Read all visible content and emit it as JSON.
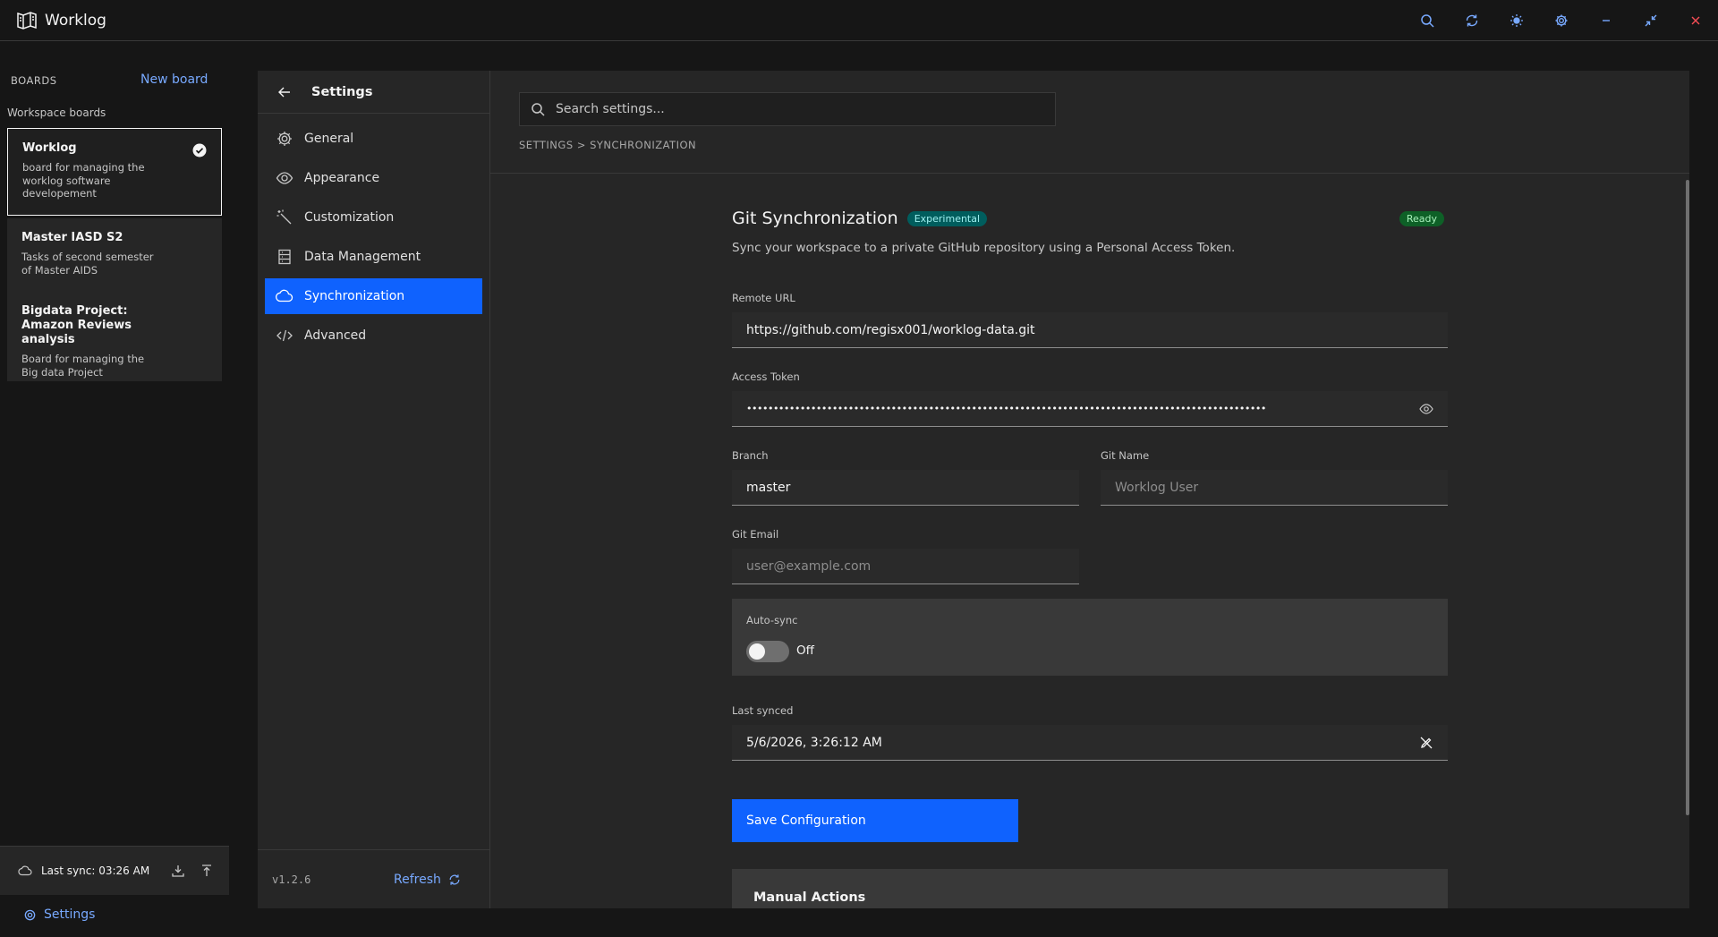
{
  "app": {
    "title": "Worklog"
  },
  "sidebar": {
    "boards_header": "BOARDS",
    "new_board": "New board",
    "workspace_label": "Workspace boards",
    "boards": [
      {
        "title": "Worklog",
        "desc": "board for managing the worklog software developement",
        "active": true
      },
      {
        "title": "Master IASD S2",
        "desc": "Tasks of second semester of Master AIDS",
        "active": false
      },
      {
        "title": "Bigdata Project: Amazon Reviews analysis",
        "desc": "Board for managing the Big data Project",
        "active": false
      }
    ],
    "last_sync": "Last sync: 03:26 AM",
    "settings_label": "Settings"
  },
  "settings_nav": {
    "title": "Settings",
    "items": [
      {
        "label": "General",
        "icon": "gear-icon"
      },
      {
        "label": "Appearance",
        "icon": "eye-icon"
      },
      {
        "label": "Customization",
        "icon": "magic-wand-icon"
      },
      {
        "label": "Data Management",
        "icon": "database-icon"
      },
      {
        "label": "Synchronization",
        "icon": "cloud-icon"
      },
      {
        "label": "Advanced",
        "icon": "code-icon"
      }
    ],
    "active_index": 4,
    "version": "v1.2.6",
    "refresh_label": "Refresh"
  },
  "content": {
    "search_placeholder": "Search settings...",
    "breadcrumb": "SETTINGS > SYNCHRONIZATION",
    "form": {
      "title": "Git Synchronization",
      "badge": "Experimental",
      "status": "Ready",
      "description": "Sync your workspace to a private GitHub repository using a Personal Access Token.",
      "remote_url_label": "Remote URL",
      "remote_url_value": "https://github.com/regisx001/worklog-data.git",
      "access_token_label": "Access Token",
      "access_token_value": "•••••••••••••••••••••••••••••••••••••••••••••••••••••••••••••••••••••••••••••••••••••••••••••••••",
      "branch_label": "Branch",
      "branch_value": "master",
      "git_name_label": "Git Name",
      "git_name_placeholder": "Worklog User",
      "git_email_label": "Git Email",
      "git_email_placeholder": "user@example.com",
      "autosync_label": "Auto-sync",
      "autosync_state": "Off",
      "last_synced_label": "Last synced",
      "last_synced_value": "5/6/2026, 3:26:12 AM",
      "save_label": "Save Configuration",
      "manual_actions_title": "Manual Actions"
    }
  },
  "colors": {
    "accent": "#0f62fe",
    "link": "#78a9ff",
    "close": "#fa4d56"
  }
}
